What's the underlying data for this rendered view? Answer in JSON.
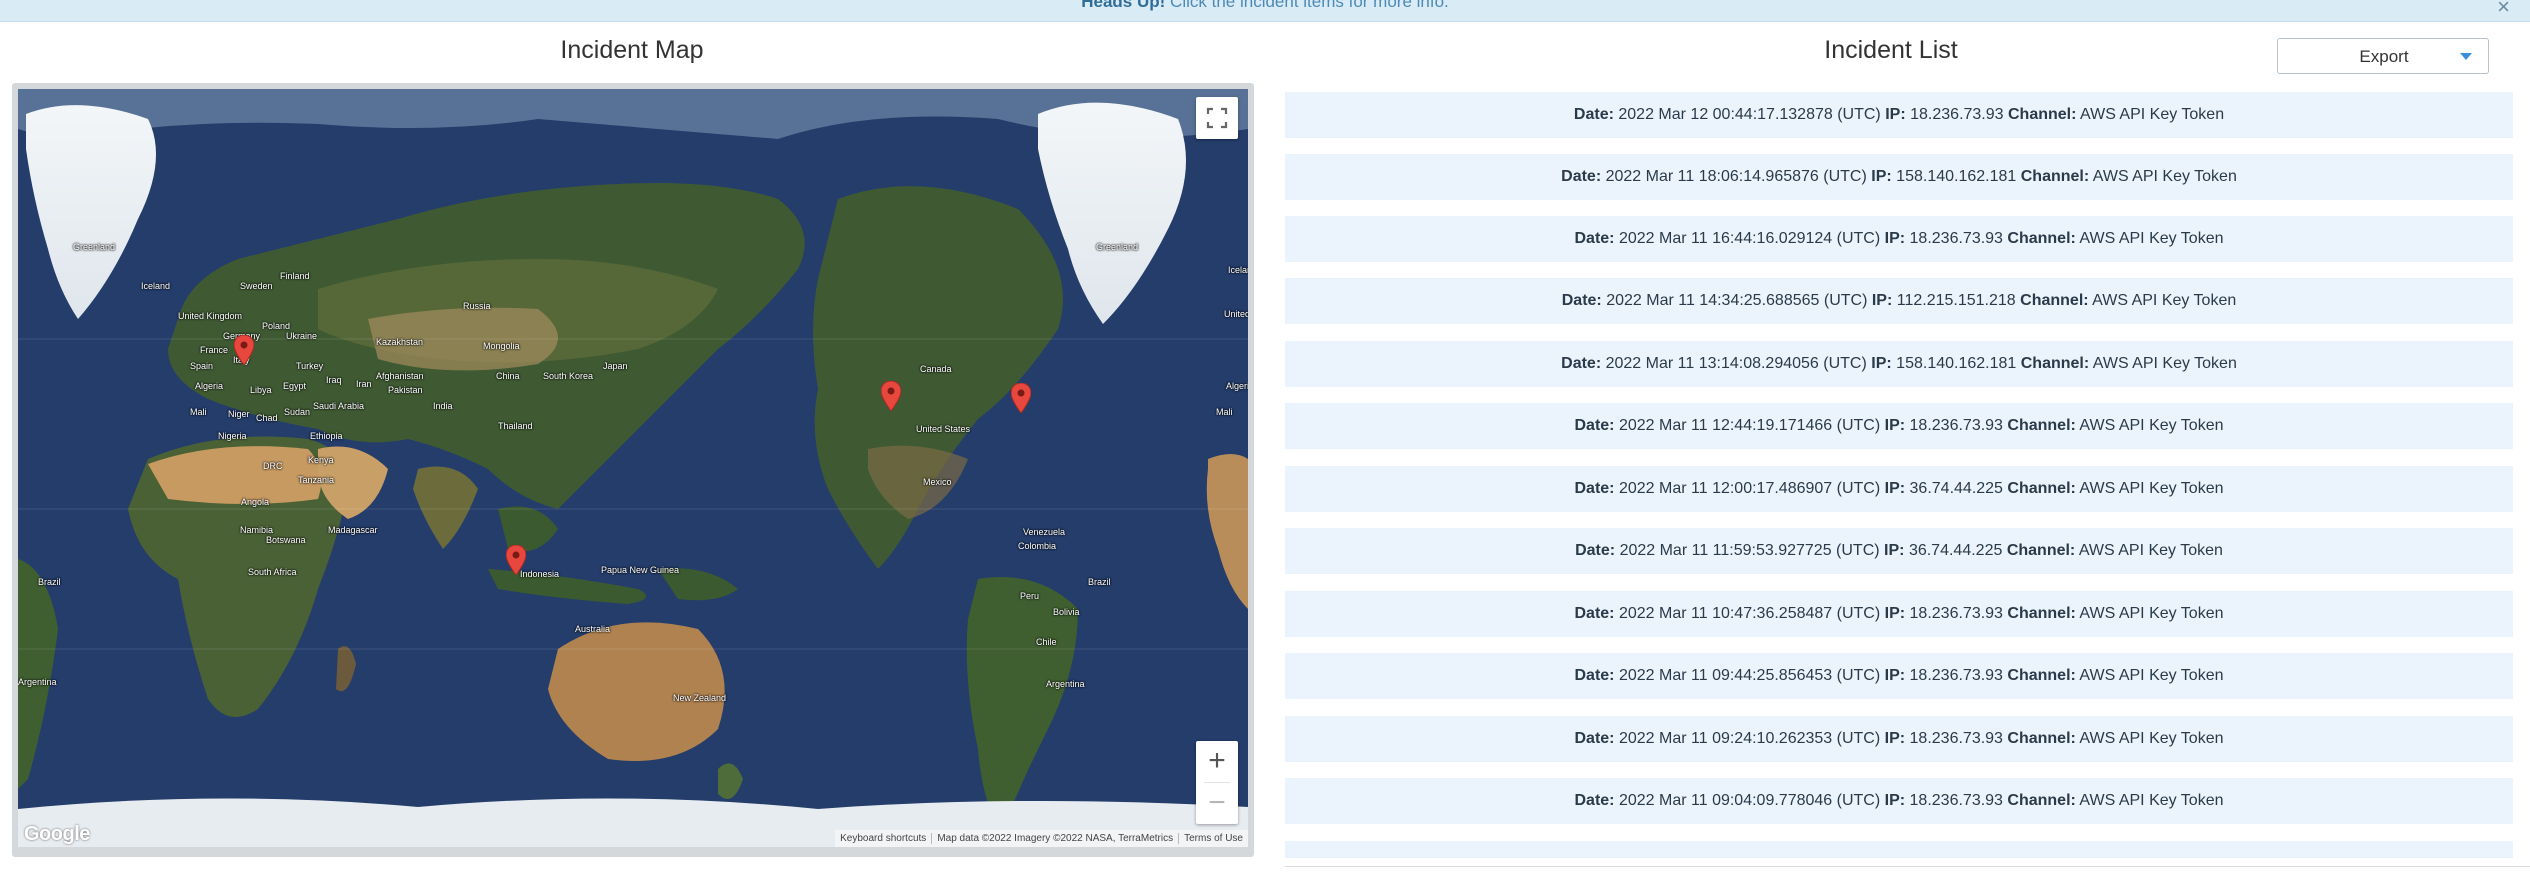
{
  "alert": {
    "title": "Heads Up!",
    "message": "Click the incident items for more info.",
    "close": "×"
  },
  "map_panel": {
    "title": "Incident Map",
    "labels": [
      {
        "text": "Greenland"
      },
      {
        "text": "Greenland"
      },
      {
        "text": "Iceland"
      },
      {
        "text": "Sweden"
      },
      {
        "text": "Finland"
      },
      {
        "text": "United Kingdom"
      },
      {
        "text": "Germany"
      },
      {
        "text": "Poland"
      },
      {
        "text": "Ukraine"
      },
      {
        "text": "France"
      },
      {
        "text": "Spain"
      },
      {
        "text": "Italy"
      },
      {
        "text": "Turkey"
      },
      {
        "text": "Russia"
      },
      {
        "text": "Kazakhstan"
      },
      {
        "text": "Mongolia"
      },
      {
        "text": "China"
      },
      {
        "text": "Japan"
      },
      {
        "text": "South Korea"
      },
      {
        "text": "Afghanistan"
      },
      {
        "text": "Pakistan"
      },
      {
        "text": "Iran"
      },
      {
        "text": "Iraq"
      },
      {
        "text": "India"
      },
      {
        "text": "Thailand"
      },
      {
        "text": "Saudi Arabia"
      },
      {
        "text": "Algeria"
      },
      {
        "text": "Libya"
      },
      {
        "text": "Egypt"
      },
      {
        "text": "Mali"
      },
      {
        "text": "Niger"
      },
      {
        "text": "Chad"
      },
      {
        "text": "Sudan"
      },
      {
        "text": "Nigeria"
      },
      {
        "text": "Ethiopia"
      },
      {
        "text": "DRC"
      },
      {
        "text": "Kenya"
      },
      {
        "text": "Tanzania"
      },
      {
        "text": "Angola"
      },
      {
        "text": "Namibia"
      },
      {
        "text": "Botswana"
      },
      {
        "text": "Madagascar"
      },
      {
        "text": "South Africa"
      },
      {
        "text": "Indonesia"
      },
      {
        "text": "Papua New Guinea"
      },
      {
        "text": "Australia"
      },
      {
        "text": "New Zealand"
      },
      {
        "text": "Canada"
      },
      {
        "text": "United States"
      },
      {
        "text": "Mexico"
      },
      {
        "text": "Venezuela"
      },
      {
        "text": "Colombia"
      },
      {
        "text": "Peru"
      },
      {
        "text": "Brazil"
      },
      {
        "text": "Bolivia"
      },
      {
        "text": "Chile"
      },
      {
        "text": "Argentina"
      },
      {
        "text": "Brazil"
      },
      {
        "text": "Argentina"
      },
      {
        "text": "Algeria"
      },
      {
        "text": "Mali"
      },
      {
        "text": "Iceland"
      },
      {
        "text": "United Kingdom"
      }
    ],
    "google_logo": "Google",
    "attribution": {
      "shortcuts": "Keyboard shortcuts",
      "map_data": "Map data ©2022 Imagery ©2022 NASA, TerraMetrics",
      "terms": "Terms of Use"
    },
    "zoom_in": "+",
    "zoom_out": "−",
    "marker_color": "#e8473e"
  },
  "list_panel": {
    "title": "Incident List",
    "export_label": "Export",
    "field_labels": {
      "date": "Date:",
      "ip": "IP:",
      "channel": "Channel:"
    },
    "incidents": [
      {
        "date": "2022 Mar 12 00:44:17.132878 (UTC)",
        "ip": "18.236.73.93",
        "channel": "AWS API Key Token"
      },
      {
        "date": "2022 Mar 11 18:06:14.965876 (UTC)",
        "ip": "158.140.162.181",
        "channel": "AWS API Key Token"
      },
      {
        "date": "2022 Mar 11 16:44:16.029124 (UTC)",
        "ip": "18.236.73.93",
        "channel": "AWS API Key Token"
      },
      {
        "date": "2022 Mar 11 14:34:25.688565 (UTC)",
        "ip": "112.215.151.218",
        "channel": "AWS API Key Token"
      },
      {
        "date": "2022 Mar 11 13:14:08.294056 (UTC)",
        "ip": "158.140.162.181",
        "channel": "AWS API Key Token"
      },
      {
        "date": "2022 Mar 11 12:44:19.171466 (UTC)",
        "ip": "18.236.73.93",
        "channel": "AWS API Key Token"
      },
      {
        "date": "2022 Mar 11 12:00:17.486907 (UTC)",
        "ip": "36.74.44.225",
        "channel": "AWS API Key Token"
      },
      {
        "date": "2022 Mar 11 11:59:53.927725 (UTC)",
        "ip": "36.74.44.225",
        "channel": "AWS API Key Token"
      },
      {
        "date": "2022 Mar 11 10:47:36.258487 (UTC)",
        "ip": "18.236.73.93",
        "channel": "AWS API Key Token"
      },
      {
        "date": "2022 Mar 11 09:44:25.856453 (UTC)",
        "ip": "18.236.73.93",
        "channel": "AWS API Key Token"
      },
      {
        "date": "2022 Mar 11 09:24:10.262353 (UTC)",
        "ip": "18.236.73.93",
        "channel": "AWS API Key Token"
      },
      {
        "date": "2022 Mar 11 09:04:09.778046 (UTC)",
        "ip": "18.236.73.93",
        "channel": "AWS API Key Token"
      },
      {
        "date": "",
        "ip": "",
        "channel": ""
      }
    ]
  }
}
